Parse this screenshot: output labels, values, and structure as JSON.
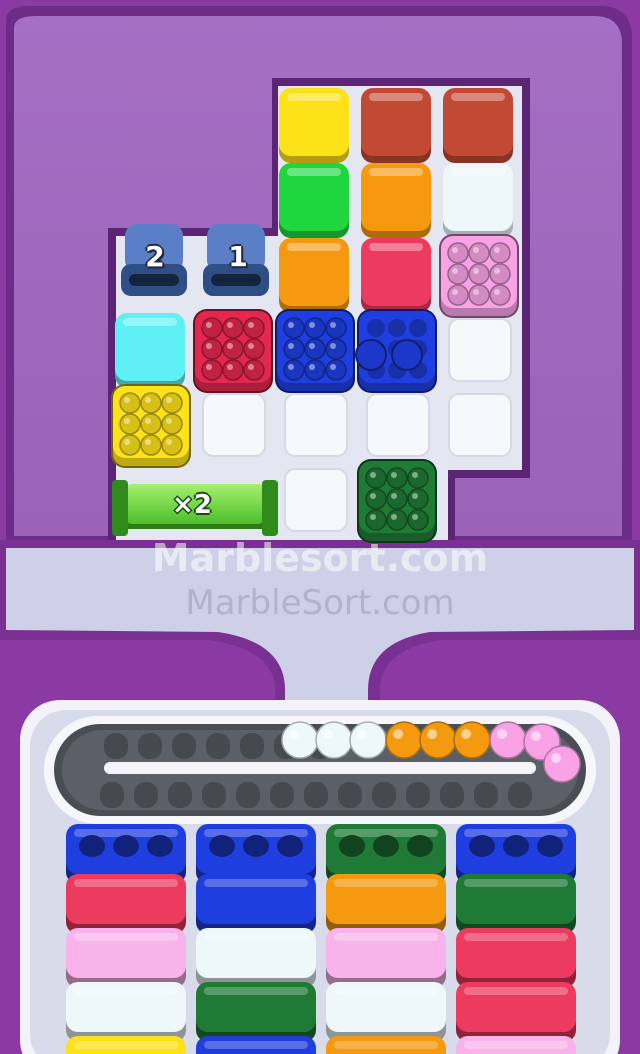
{
  "watermarks": {
    "primary": "Marblesort.com",
    "secondary": "MarbleSort.com"
  },
  "board": {
    "solid_tiles": [
      {
        "col": 2,
        "row": 0,
        "color": "yellow"
      },
      {
        "col": 3,
        "row": 0,
        "color": "brown"
      },
      {
        "col": 4,
        "row": 0,
        "color": "brown"
      },
      {
        "col": 2,
        "row": 1,
        "color": "green"
      },
      {
        "col": 3,
        "row": 1,
        "color": "orange"
      },
      {
        "col": 4,
        "row": 1,
        "color": "white"
      },
      {
        "col": 2,
        "row": 2,
        "color": "orange"
      },
      {
        "col": 3,
        "row": 2,
        "color": "crimson"
      },
      {
        "col": 0,
        "row": 3,
        "color": "cyan"
      }
    ],
    "marble_boxes": [
      {
        "col": 4,
        "row": 2,
        "color": "pink",
        "marbles": 9
      },
      {
        "col": 1,
        "row": 3,
        "color": "red",
        "marbles": 9
      },
      {
        "col": 2,
        "row": 3,
        "color": "blue",
        "marbles": 9
      },
      {
        "col": 3,
        "row": 3,
        "color": "blue",
        "marbles": 2
      },
      {
        "col": 0,
        "row": 4,
        "color": "yellow",
        "marbles": 9
      },
      {
        "col": 3,
        "row": 5,
        "color": "dark-green",
        "marbles": 9
      }
    ],
    "empty_slots": [
      {
        "col": 4,
        "row": 3
      },
      {
        "col": 1,
        "row": 4
      },
      {
        "col": 2,
        "row": 4
      },
      {
        "col": 3,
        "row": 4
      },
      {
        "col": 4,
        "row": 4
      },
      {
        "col": 2,
        "row": 5
      }
    ],
    "counter_blocks": [
      {
        "col": 0,
        "row": 2,
        "value": "2"
      },
      {
        "col": 1,
        "row": 2,
        "value": "1"
      }
    ],
    "booster": {
      "label": "×2"
    }
  },
  "conveyor": {
    "marbles": [
      "white",
      "white",
      "white",
      "orange",
      "orange",
      "orange",
      "pink",
      "pink",
      "pink"
    ]
  },
  "columns": [
    [
      "blue",
      "crimson",
      "light-pink",
      "white",
      "yellow"
    ],
    [
      "blue",
      "blue",
      "white",
      "dark-green",
      "blue"
    ],
    [
      "dark-green",
      "orange",
      "light-pink",
      "white",
      "orange"
    ],
    [
      "blue",
      "dark-green",
      "crimson",
      "crimson",
      "light-pink"
    ]
  ],
  "palette": {
    "yellow": "#fde21a",
    "brown": "#c24a35",
    "green": "#1fd63f",
    "orange": "#f59a0f",
    "white": "#eef8fb",
    "crimson": "#ec3b5f",
    "cyan": "#5ff0f5",
    "pink": "#f9a3e6",
    "light-pink": "#f8b4ea",
    "red": "#e3274e",
    "blue": "#1f3ee0",
    "dark-green": "#1f7a36",
    "purple-dark": "#6b2a86",
    "purple-mid": "#a36ac0",
    "tray": "#e9e9f3"
  }
}
